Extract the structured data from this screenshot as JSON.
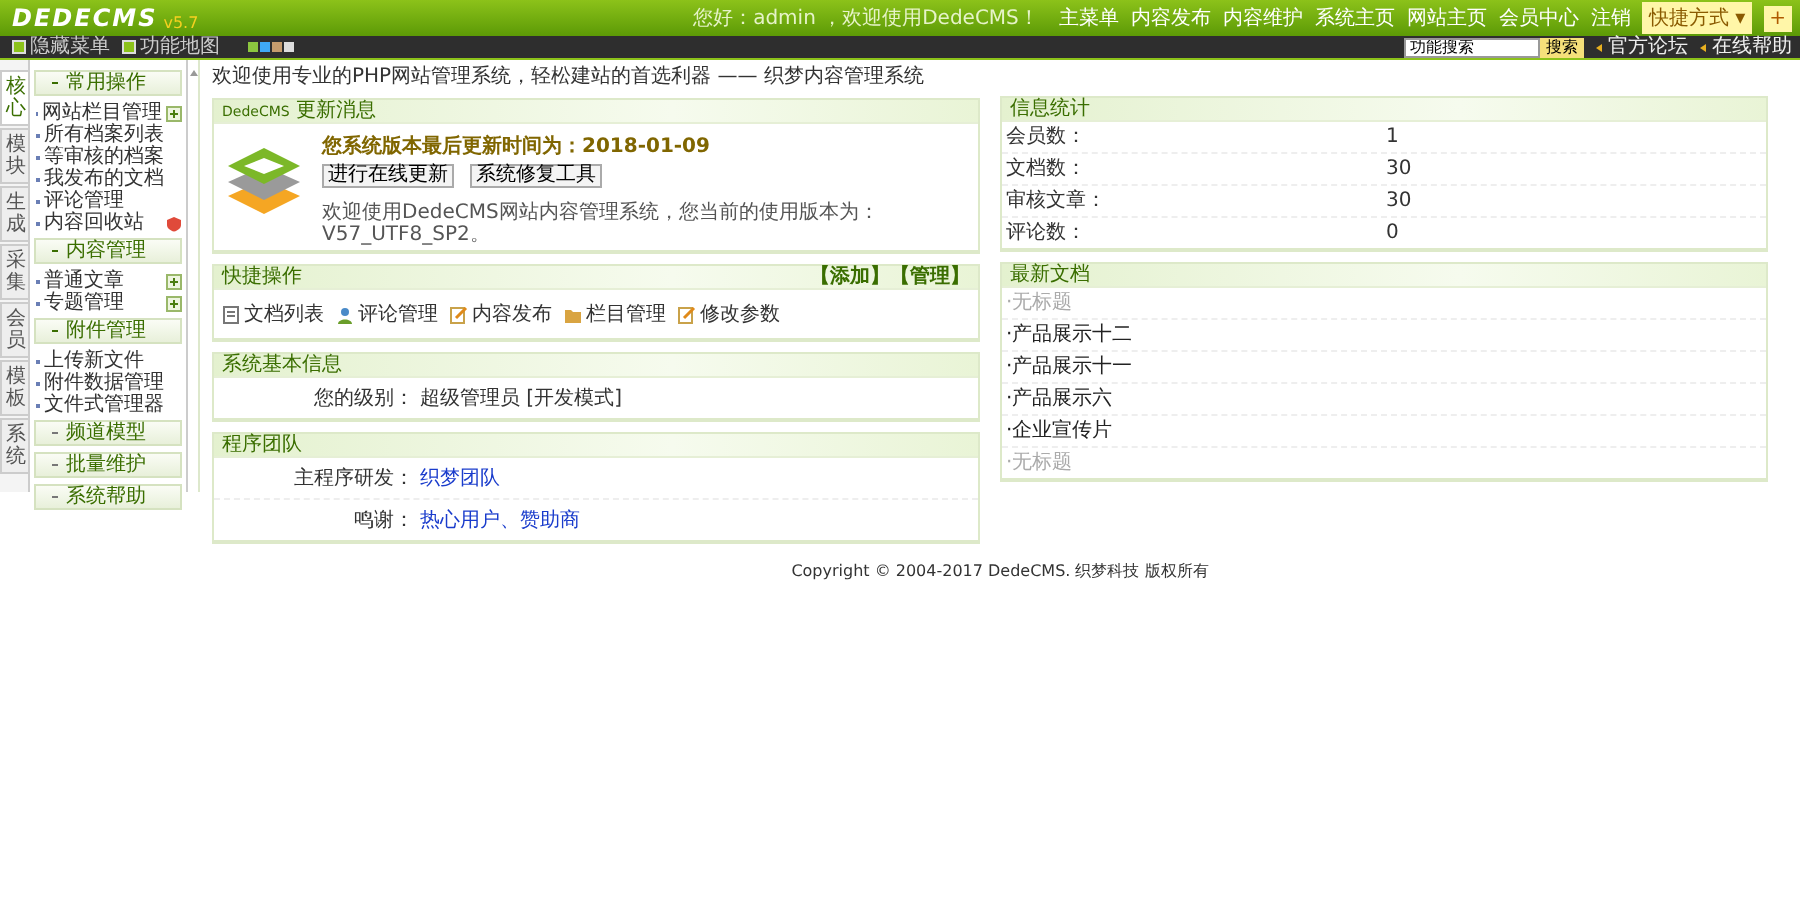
{
  "header": {
    "logo": "DEDECMS",
    "version": "v5.7",
    "greeting": "您好：admin ，欢迎使用DedeCMS！",
    "nav": [
      "主菜单",
      "内容发布",
      "内容维护",
      "系统主页",
      "网站主页",
      "会员中心",
      "注销"
    ],
    "shortcut": {
      "label": "快捷方式",
      "caret": "▾",
      "plus": "+"
    }
  },
  "toolbar": {
    "items": [
      "隐藏菜单",
      "功能地图"
    ],
    "skins": [
      {
        "color": "#8cc63f"
      },
      {
        "color": "#3fa9f5"
      },
      {
        "color": "#c69c6d"
      },
      {
        "color": "#dddddd"
      }
    ],
    "search": {
      "value": "功能搜索",
      "button": "搜索"
    },
    "links": [
      "官方论坛",
      "在线帮助"
    ]
  },
  "sidebar": {
    "tabs": [
      {
        "label": "核心",
        "selected": true
      },
      {
        "label": "模块",
        "selected": false
      },
      {
        "label": "生成",
        "selected": false
      },
      {
        "label": "采集",
        "selected": false
      },
      {
        "label": "会员",
        "selected": false
      },
      {
        "label": "模板",
        "selected": false
      },
      {
        "label": "系统",
        "selected": false
      }
    ],
    "groups": [
      {
        "title": "常用操作",
        "expanded": true,
        "items": [
          {
            "label": "网站栏目管理",
            "kind": "add"
          },
          {
            "label": "所有档案列表",
            "kind": "plain"
          },
          {
            "label": "等审核的档案",
            "kind": "plain"
          },
          {
            "label": "我发布的文档",
            "kind": "plain"
          },
          {
            "label": "评论管理",
            "kind": "plain"
          },
          {
            "label": "内容回收站",
            "kind": "alert"
          }
        ]
      },
      {
        "title": "内容管理",
        "expanded": true,
        "items": [
          {
            "label": "普通文章",
            "kind": "add"
          },
          {
            "label": "专题管理",
            "kind": "add"
          }
        ]
      },
      {
        "title": "附件管理",
        "expanded": true,
        "items": [
          {
            "label": "上传新文件",
            "kind": "plain"
          },
          {
            "label": "附件数据管理",
            "kind": "plain"
          },
          {
            "label": "文件式管理器",
            "kind": "plain"
          }
        ]
      },
      {
        "title": "频道模型",
        "expanded": false
      },
      {
        "title": "批量维护",
        "expanded": false
      },
      {
        "title": "系统帮助",
        "expanded": false
      }
    ]
  },
  "welcome": "欢迎使用专业的PHP网站管理系统，轻松建站的首选利器 —— 织梦内容管理系统",
  "update": {
    "title_brand": "DedeCMS",
    "title": "更新消息",
    "notice": "您系统版本最后更新时间为：2018-01-09",
    "buttons": [
      "进行在线更新",
      "系统修复工具"
    ],
    "version_text": "欢迎使用DedeCMS网站内容管理系统，您当前的使用版本为：V57_UTF8_SP2。"
  },
  "quick": {
    "title": "快捷操作",
    "actions": [
      "【添加】",
      "【管理】"
    ],
    "items": [
      {
        "label": "文档列表",
        "kind": "doc"
      },
      {
        "label": "评论管理",
        "kind": "user"
      },
      {
        "label": "内容发布",
        "kind": "edit"
      },
      {
        "label": "栏目管理",
        "kind": "folder"
      },
      {
        "label": "修改参数",
        "kind": "edit"
      }
    ]
  },
  "sysinfo": {
    "title": "系统基本信息",
    "rows": [
      {
        "label": "您的级别：",
        "value": "超级管理员 [开发模式]"
      }
    ]
  },
  "team": {
    "title": "程序团队",
    "rows": [
      {
        "label": "主程序研发：",
        "value": "织梦团队"
      },
      {
        "label": "鸣谢：",
        "value": "热心用户、赞助商"
      }
    ]
  },
  "stats": {
    "title": "信息统计",
    "rows": [
      {
        "label": "会员数：",
        "value": "1"
      },
      {
        "label": "文档数：",
        "value": "30"
      },
      {
        "label": "审核文章：",
        "value": "30"
      },
      {
        "label": "评论数：",
        "value": "0"
      }
    ]
  },
  "latest": {
    "title": "最新文档",
    "items": [
      {
        "label": "·无标题",
        "disabled": true
      },
      {
        "label": "·产品展示十二",
        "disabled": false
      },
      {
        "label": "·产品展示十一",
        "disabled": false
      },
      {
        "label": "·产品展示六",
        "disabled": false
      },
      {
        "label": "·企业宣传片",
        "disabled": false
      },
      {
        "label": "·无标题",
        "disabled": true
      }
    ]
  },
  "footer": "Copyright © 2004-2017 DedeCMS. 织梦科技 版权所有"
}
